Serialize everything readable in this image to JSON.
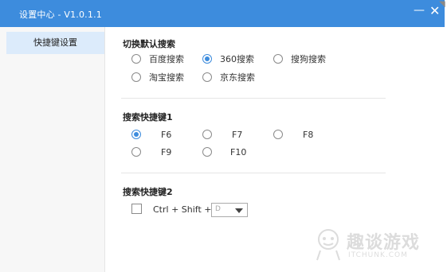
{
  "window": {
    "title": "设置中心 - V1.0.1.1",
    "minimize_icon": "minimize-icon",
    "close_icon": "close-icon",
    "accent_color": "#3d8cdd"
  },
  "sidebar": {
    "items": [
      {
        "label": "快捷键设置",
        "selected": true
      }
    ]
  },
  "search_switch": {
    "title": "切换默认搜索",
    "options": [
      {
        "label": "百度搜索",
        "selected": false
      },
      {
        "label": "360搜索",
        "selected": true
      },
      {
        "label": "搜狗搜索",
        "selected": false
      },
      {
        "label": "淘宝搜索",
        "selected": false
      },
      {
        "label": "京东搜索",
        "selected": false
      }
    ]
  },
  "hotkey1": {
    "title": "搜索快捷键1",
    "options": [
      {
        "label": "F6",
        "selected": true
      },
      {
        "label": "F7",
        "selected": false
      },
      {
        "label": "F8",
        "selected": false
      },
      {
        "label": "F9",
        "selected": false
      },
      {
        "label": "F10",
        "selected": false
      }
    ]
  },
  "hotkey2": {
    "title": "搜索快捷键2",
    "checked": false,
    "combo_text": "Ctrl + Shift +",
    "key_value": "D"
  },
  "watermark": {
    "text": "趣谈游戏",
    "sub": "ITCHUNK.COM"
  }
}
